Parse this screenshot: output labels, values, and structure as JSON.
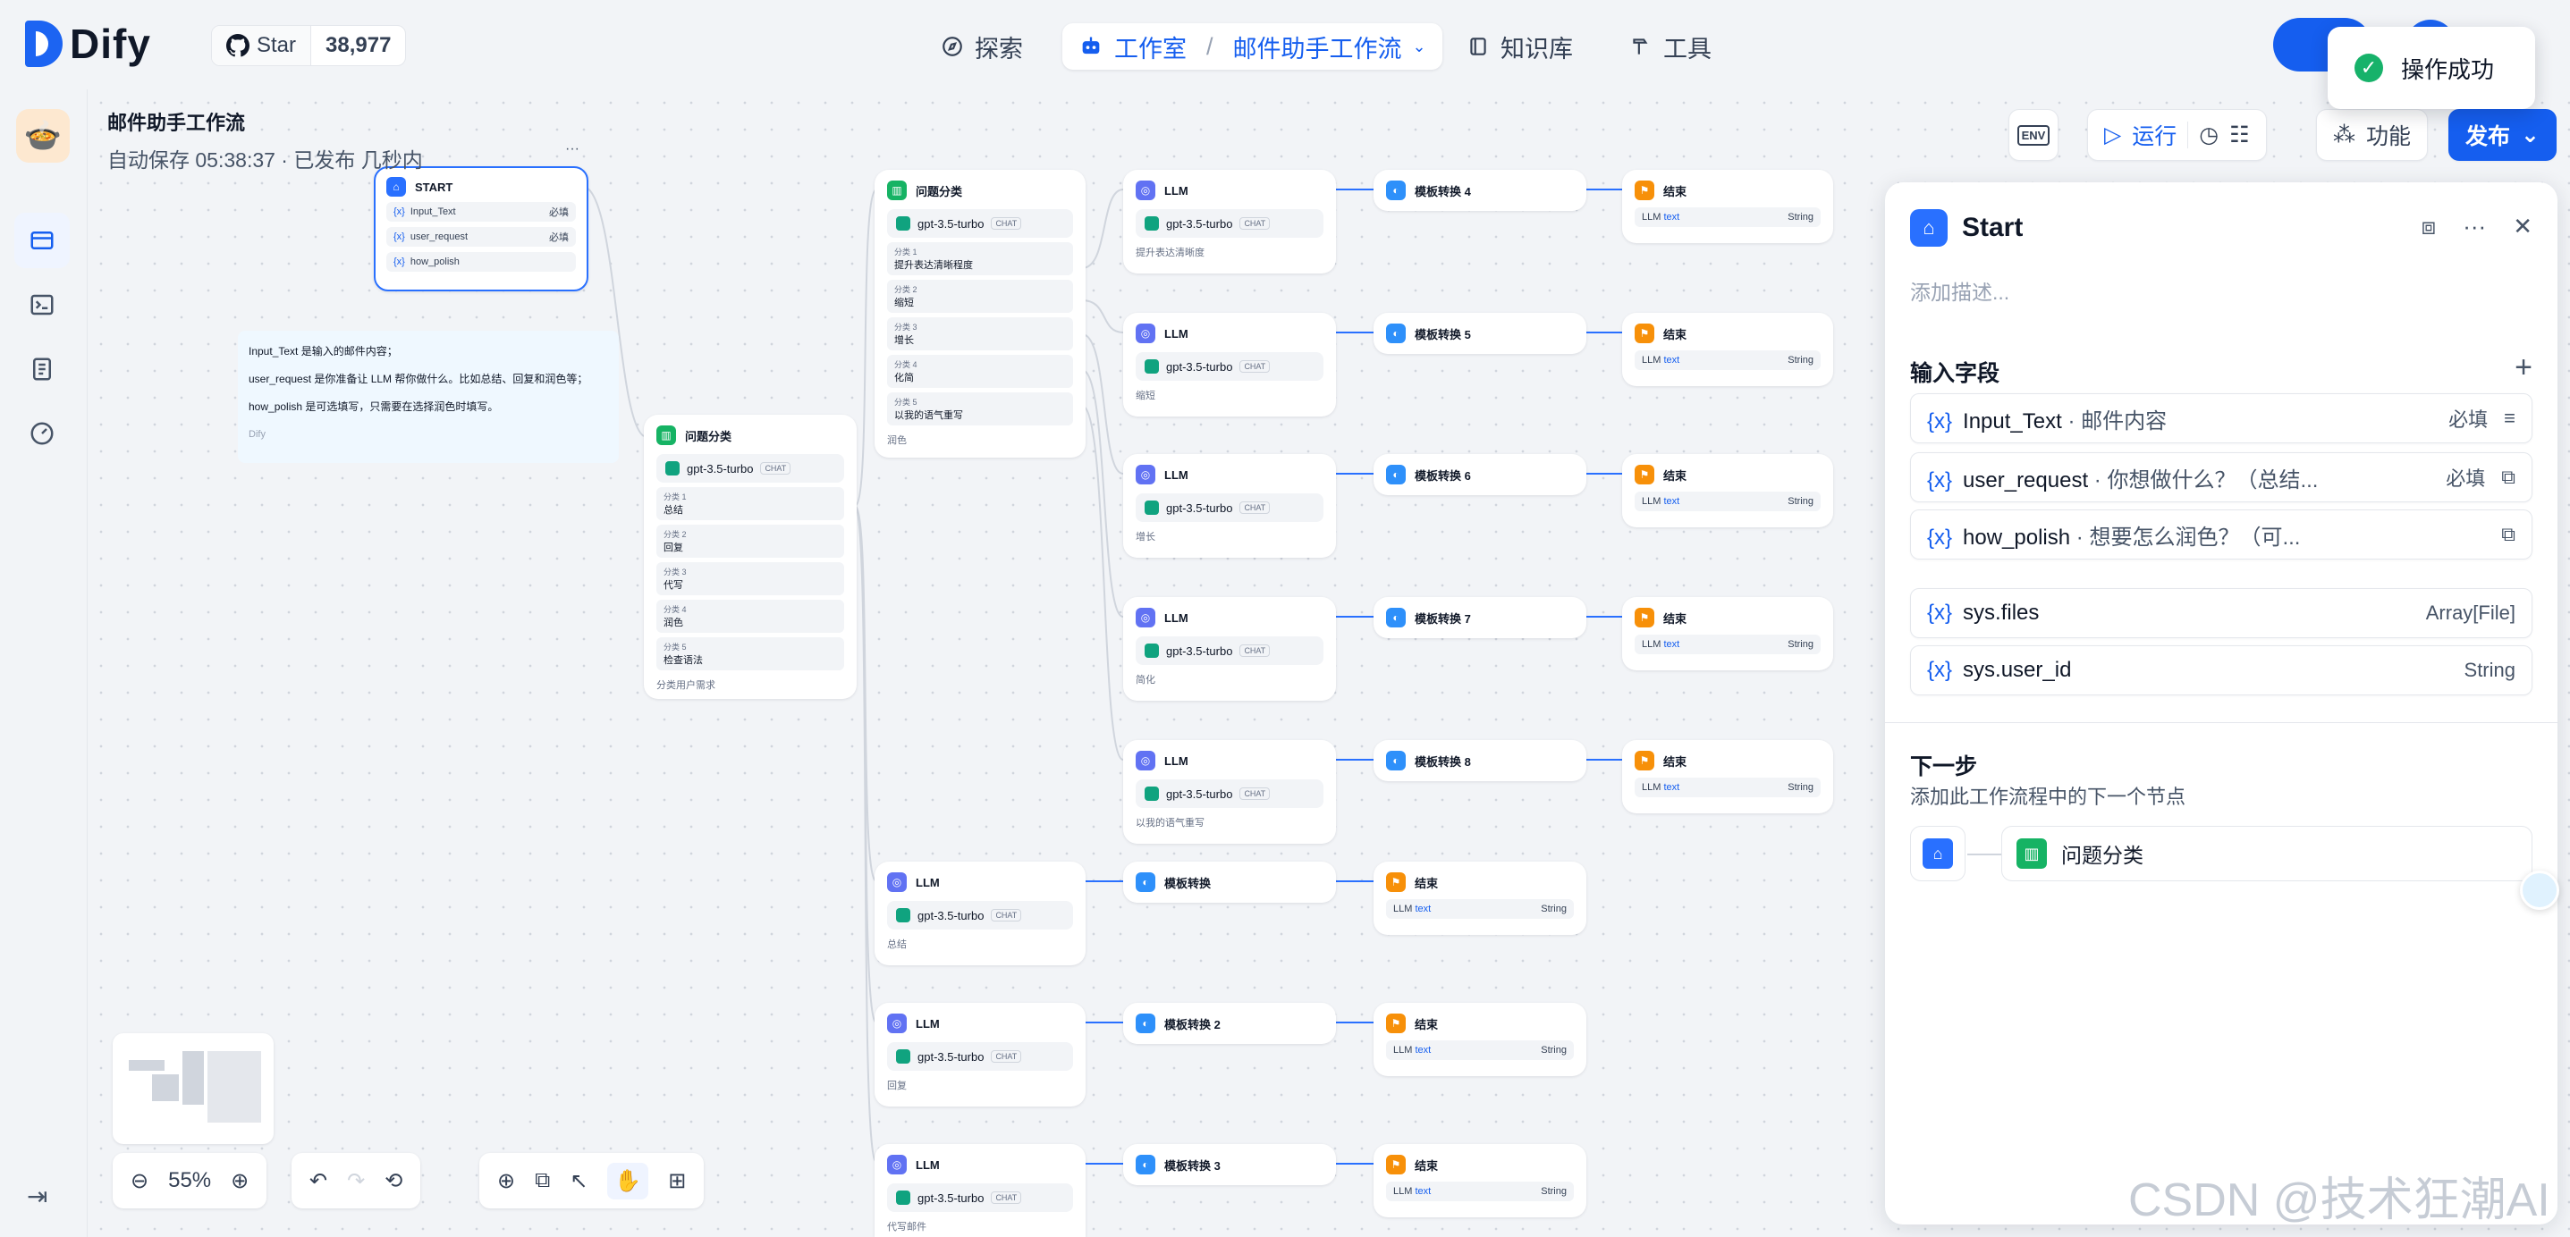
{
  "app": {
    "logo": "Dify",
    "star_label": "Star",
    "star_count": "38,977"
  },
  "nav": {
    "explore": "探索",
    "studio": "工作室",
    "workflow": "邮件助手工作流",
    "knowledge": "知识库",
    "tools": "工具"
  },
  "toast": {
    "message": "操作成功"
  },
  "workflow": {
    "title": "邮件助手工作流",
    "status": "自动保存 05:38:37 · 已发布 几秒内"
  },
  "toolbar": {
    "env": "ENV",
    "run": "运行",
    "features": "功能",
    "publish": "发布"
  },
  "nodes": {
    "start": {
      "title": "START",
      "vars": [
        {
          "name": "Input_Text",
          "tag": "必填"
        },
        {
          "name": "user_request",
          "tag": "必填"
        },
        {
          "name": "how_polish",
          "tag": ""
        }
      ]
    },
    "qc1": {
      "title": "问题分类",
      "model": "gpt-3.5-turbo",
      "chat": "CHAT",
      "classes": [
        {
          "k": "分类 1",
          "v": "总结"
        },
        {
          "k": "分类 2",
          "v": "回复"
        },
        {
          "k": "分类 3",
          "v": "代写"
        },
        {
          "k": "分类 4",
          "v": "润色"
        },
        {
          "k": "分类 5",
          "v": "检查语法"
        }
      ],
      "foot": "分类用户需求"
    },
    "qc2": {
      "title": "问题分类",
      "model": "gpt-3.5-turbo",
      "chat": "CHAT",
      "classes": [
        {
          "k": "分类 1",
          "v": "提升表达清晰程度"
        },
        {
          "k": "分类 2",
          "v": "缩短"
        },
        {
          "k": "分类 3",
          "v": "增长"
        },
        {
          "k": "分类 4",
          "v": "化简"
        },
        {
          "k": "分类 5",
          "v": "以我的语气重写"
        }
      ],
      "foot": "润色"
    },
    "llm_title": "LLM",
    "llm_feet": [
      "提升表达清晰度",
      "缩短",
      "增长",
      "简化",
      "以我的语气重写",
      "总结",
      "回复",
      "代写邮件"
    ],
    "tpl_titles": [
      "模板转换 4",
      "模板转换 5",
      "模板转换 6",
      "模板转换 7",
      "模板转换 8",
      "模板转换",
      "模板转换 2",
      "模板转换 3"
    ],
    "end_title": "结束",
    "end_src": "LLM",
    "end_var": "text",
    "end_type": "String"
  },
  "note": {
    "lines": [
      "Input_Text 是输入的邮件内容；",
      "user_request 是你准备让 LLM 帮你做什么。比如总结、回复和润色等；",
      "how_polish 是可选填写，只需要在选择润色时填写。"
    ],
    "author": "Dify"
  },
  "panel": {
    "title": "Start",
    "description_placeholder": "添加描述...",
    "input_section": "输入字段",
    "fields": [
      {
        "name": "Input_Text",
        "label": "· 邮件内容",
        "required": "必填"
      },
      {
        "name": "user_request",
        "label": "· 你想做什么？（总结...",
        "required": "必填"
      },
      {
        "name": "how_polish",
        "label": "· 想要怎么润色？（可...",
        "required": ""
      }
    ],
    "sys_fields": [
      {
        "name": "sys.files",
        "type": "Array[File]"
      },
      {
        "name": "sys.user_id",
        "type": "String"
      }
    ],
    "next_section": "下一步",
    "next_sub": "添加此工作流程中的下一个节点",
    "next_node": "问题分类"
  },
  "controls": {
    "zoom": "55%"
  },
  "watermark": "CSDN @技术狂潮AI",
  "colors": {
    "accent": "#155eef",
    "start": "#2970ff",
    "classifier": "#16b364",
    "llm": "#6172f3",
    "template": "#2e90fa",
    "end": "#f79009"
  }
}
